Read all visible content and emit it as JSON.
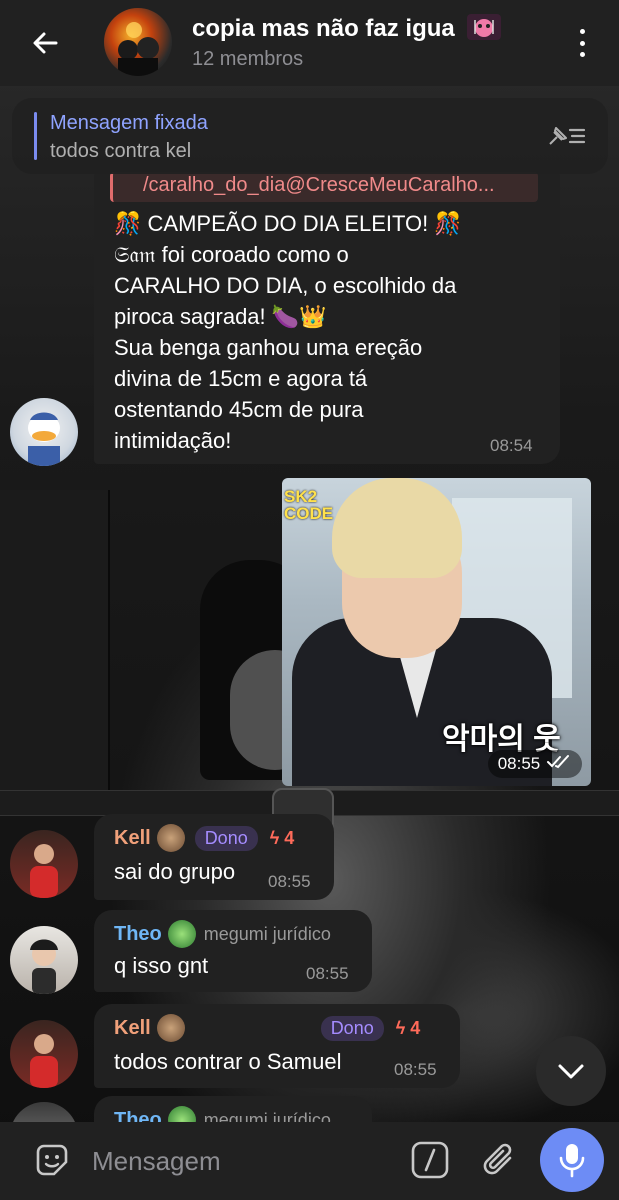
{
  "header": {
    "title": "copia mas não faz igua",
    "subtitle": "12 membros"
  },
  "pinned": {
    "label": "Mensagem fixada",
    "text": "todos contra kel"
  },
  "messages": [
    {
      "forward_from": "/caralho_do_dia@CresceMeuCaralho...",
      "lines": [
        "🎊 CAMPEÃO DO DIA ELEITO! 🎊",
        "𝔖𝔞𝔪 foi coroado como o",
        "CARALHO DO DIA, o escolhido da",
        "piroca sagrada! 🍆👑",
        "Sua benga ganhou uma ereção",
        "divina de 15cm e agora tá",
        "ostentando 45cm de pura",
        "intimidação!"
      ],
      "time": "08:54"
    },
    {
      "type": "photo",
      "photo_logo": "SK2 CODE",
      "photo_caption": "악마의 웃",
      "time": "08:55",
      "status": "read"
    },
    {
      "sender": "Kell",
      "sender_color": "#f0a07a",
      "role": "Dono",
      "boost": "4",
      "text": "sai do grupo",
      "time": "08:55"
    },
    {
      "sender": "Theo",
      "sender_color": "#6fb6f5",
      "role": "megumi jurídico",
      "text": "q isso gnt",
      "time": "08:55"
    },
    {
      "sender": "Kell",
      "sender_color": "#f0a07a",
      "role": "Dono",
      "boost": "4",
      "text": "todos contrar o Samuel",
      "time": "08:55"
    },
    {
      "sender": "Theo",
      "sender_color": "#6fb6f5",
      "role": "megumi jurídico"
    }
  ],
  "composer": {
    "placeholder": "Mensagem"
  },
  "colors": {
    "accent": "#6d8cf5",
    "bubble": "#212121",
    "header": "#212121"
  }
}
